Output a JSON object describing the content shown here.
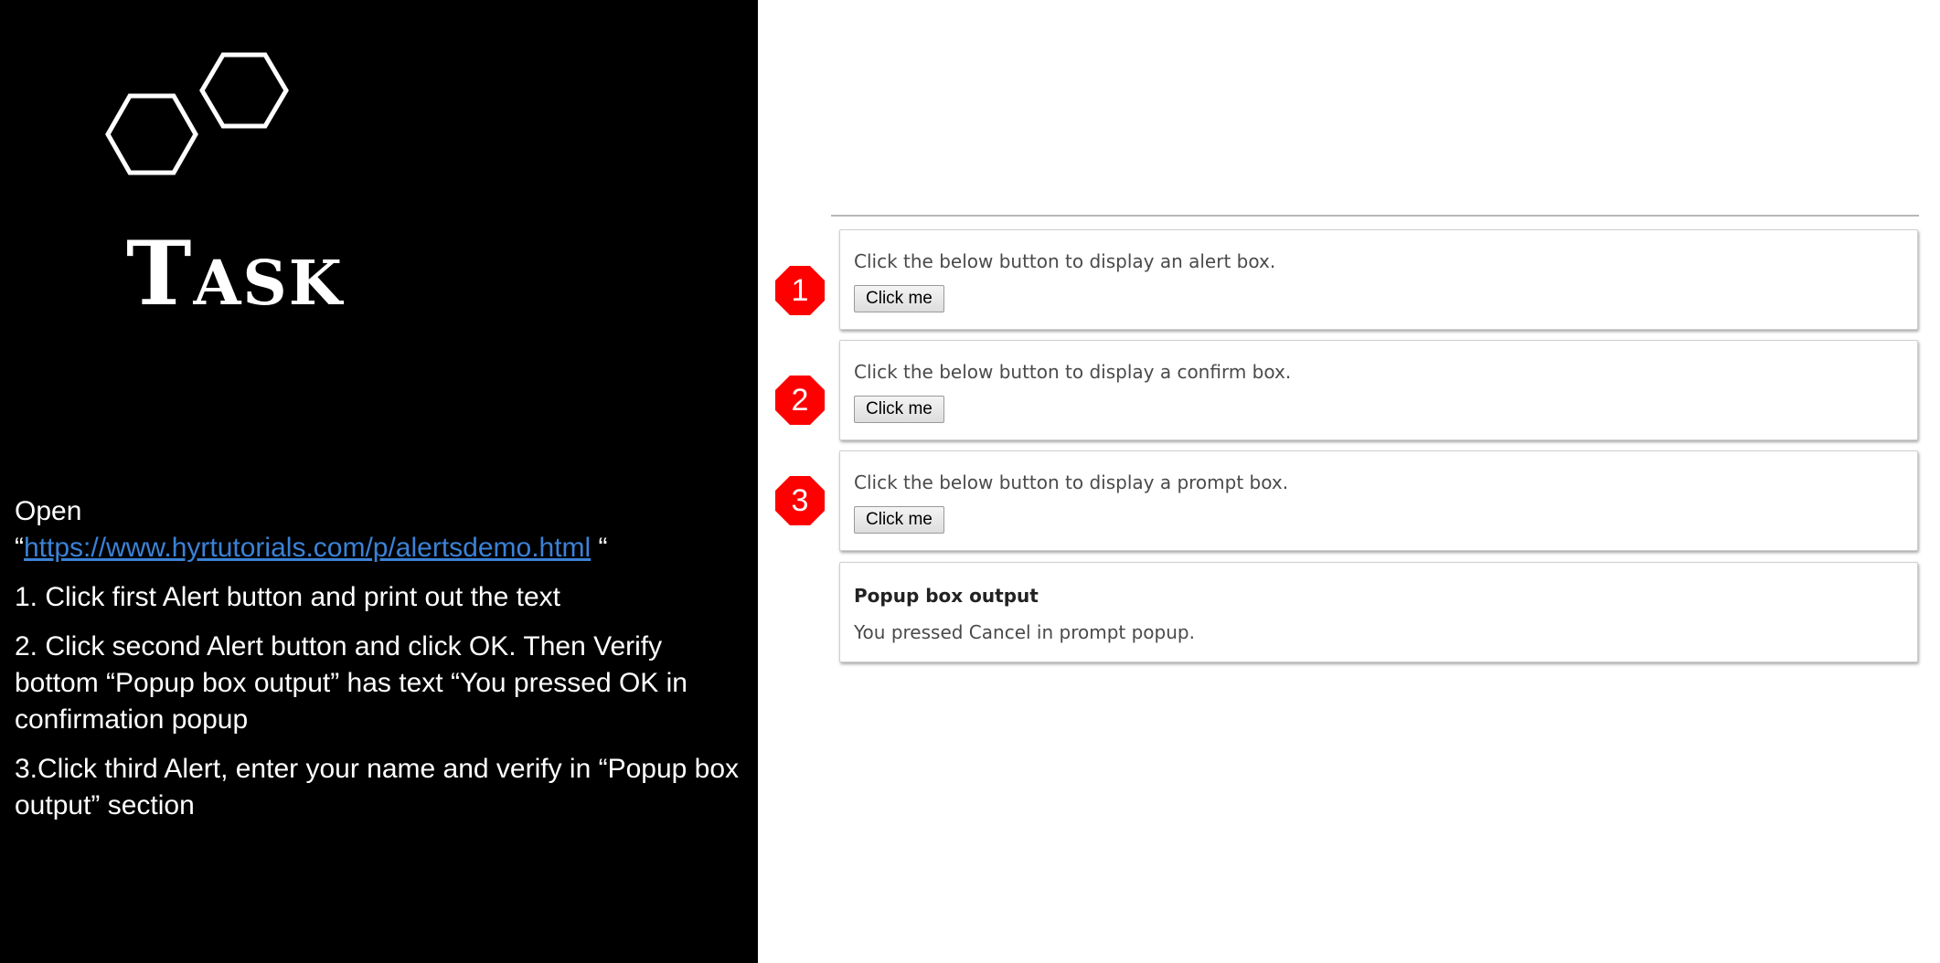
{
  "left": {
    "title": "Task",
    "open_label": "Open",
    "open_quote_start": "“",
    "url": "https://www.hyrtutorials.com/p/alertsdemo.html",
    "open_quote_end": " “",
    "steps": [
      "1. Click first Alert button and print out the text",
      "2. Click second Alert button and click OK. Then Verify bottom “Popup box output” has text “You pressed OK in confirmation popup",
      "3.Click third Alert, enter your name and verify in “Popup box output” section"
    ]
  },
  "demo": {
    "boxes": [
      {
        "badge": "1",
        "desc": "Click the below button to display an alert box.",
        "button": "Click me"
      },
      {
        "badge": "2",
        "desc": "Click the below button to display a confirm box.",
        "button": "Click me"
      },
      {
        "badge": "3",
        "desc": "Click the below button to display a prompt box.",
        "button": "Click me"
      }
    ],
    "output": {
      "title": "Popup box output",
      "text": "You pressed Cancel in prompt popup."
    }
  },
  "colors": {
    "left_background": "#000000",
    "link": "#3b82d6",
    "badge_red": "#ff0000"
  }
}
